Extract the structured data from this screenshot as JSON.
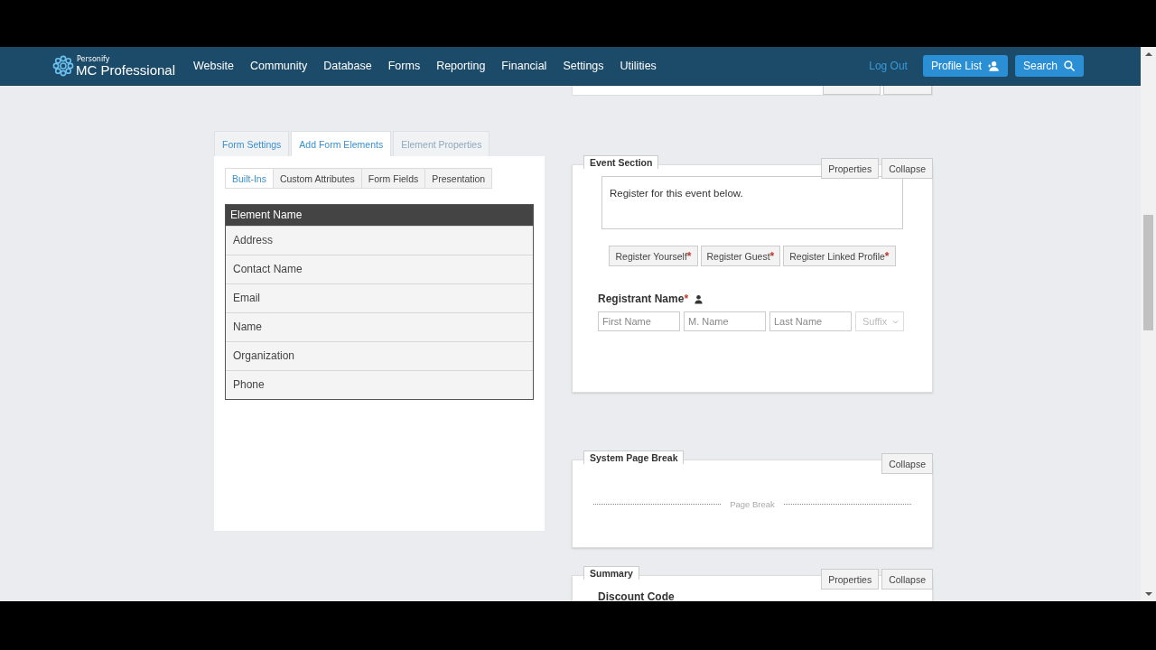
{
  "header": {
    "logo": {
      "tagline": "Personify",
      "name": "MC Professional"
    },
    "nav": [
      "Website",
      "Community",
      "Database",
      "Forms",
      "Reporting",
      "Financial",
      "Settings",
      "Utilities"
    ],
    "logout": "Log Out",
    "buttons": [
      {
        "label": "Profile List",
        "kind": "profile"
      },
      {
        "label": "Search",
        "kind": "search"
      }
    ]
  },
  "left_panel": {
    "tabs": [
      {
        "label": "Form Settings",
        "selected": false,
        "disabled": false
      },
      {
        "label": "Add Form Elements",
        "selected": true,
        "disabled": false
      },
      {
        "label": "Element Properties",
        "selected": false,
        "disabled": true
      }
    ],
    "subtabs": [
      {
        "label": "Built-Ins",
        "selected": true
      },
      {
        "label": "Custom Attributes",
        "selected": false
      },
      {
        "label": "Form Fields",
        "selected": false
      },
      {
        "label": "Presentation",
        "selected": false
      }
    ],
    "table": {
      "columns": [
        "Element Name"
      ],
      "rows": [
        "Address",
        "Contact Name",
        "Email",
        "Name",
        "Organization",
        "Phone"
      ]
    }
  },
  "sections": [
    {
      "kind": "stub"
    },
    {
      "kind": "event",
      "title": "Event Section",
      "actions": [
        "Properties",
        "Collapse"
      ],
      "intro": "Register for this event below.",
      "register_buttons": [
        {
          "label": "Register Yourself",
          "mark": "*"
        },
        {
          "label": "Register Guest",
          "mark": "*"
        },
        {
          "label": "Register Linked Profile",
          "mark": "*"
        }
      ],
      "field_label": "Registrant Name",
      "field_mark": "*",
      "inputs": [
        {
          "placeholder": "First Name"
        },
        {
          "placeholder": "M. Name"
        },
        {
          "placeholder": "Last Name"
        }
      ],
      "select": "Suffix"
    },
    {
      "kind": "pagebreak",
      "title": "System Page Break",
      "actions": [
        "Collapse"
      ],
      "text": "Page Break"
    },
    {
      "kind": "summary",
      "title": "Summary",
      "actions": [
        "Properties",
        "Collapse"
      ],
      "field_label": "Discount Code"
    }
  ]
}
